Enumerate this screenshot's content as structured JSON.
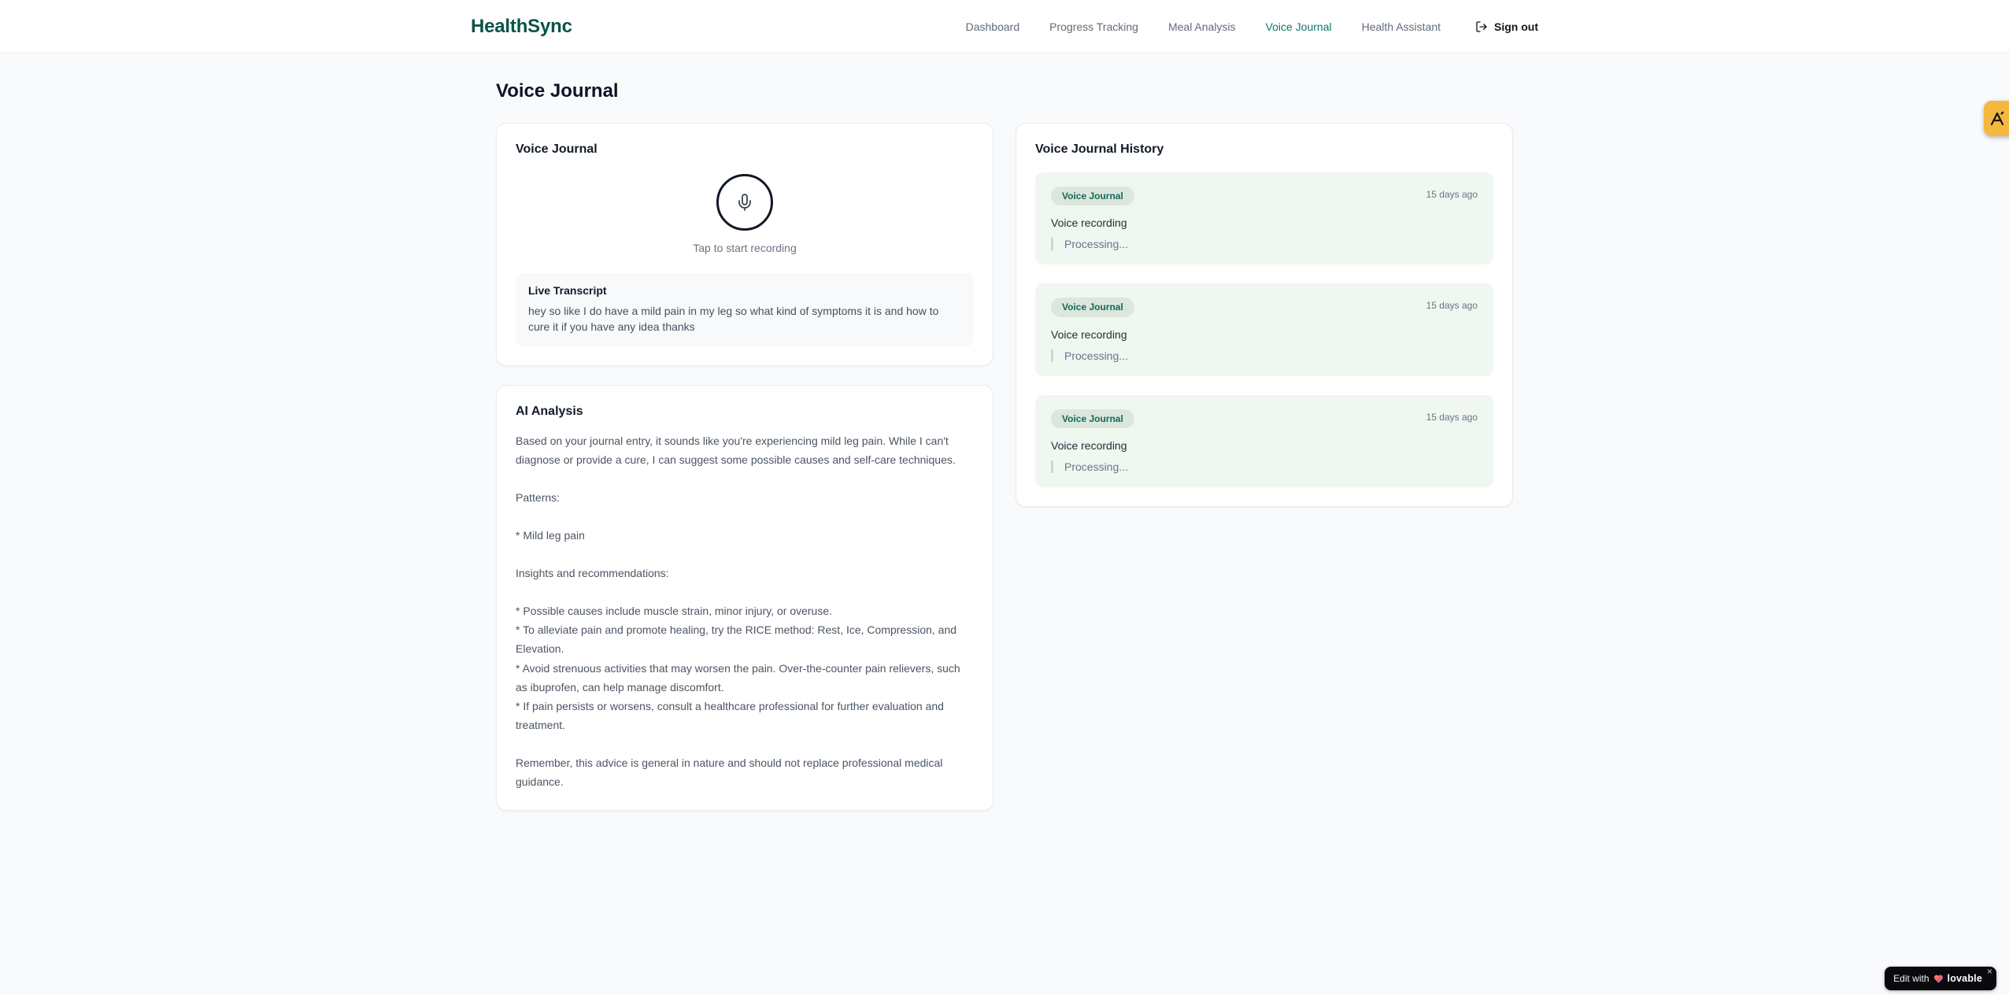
{
  "brand": {
    "name": "HealthSync",
    "color": "#0a5446"
  },
  "nav": {
    "items": [
      {
        "label": "Dashboard",
        "active": false
      },
      {
        "label": "Progress Tracking",
        "active": false
      },
      {
        "label": "Meal Analysis",
        "active": false
      },
      {
        "label": "Voice Journal",
        "active": true
      },
      {
        "label": "Health Assistant",
        "active": false
      }
    ],
    "active_color": "#11756a",
    "sign_out_label": "Sign out"
  },
  "page": {
    "title": "Voice Journal"
  },
  "recorder_card": {
    "title": "Voice Journal",
    "tap_hint": "Tap to start recording",
    "transcript_title": "Live Transcript",
    "transcript_text": "hey so like I do have a mild pain in my leg so what kind of symptoms it is and how to cure it if you have any idea thanks"
  },
  "analysis_card": {
    "title": "AI Analysis",
    "body": "Based on your journal entry, it sounds like you're experiencing mild leg pain. While I can't diagnose or provide a cure, I can suggest some possible causes and self-care techniques.\n\nPatterns:\n\n* Mild leg pain\n\nInsights and recommendations:\n\n* Possible causes include muscle strain, minor injury, or overuse.\n* To alleviate pain and promote healing, try the RICE method: Rest, Ice, Compression, and Elevation.\n* Avoid strenuous activities that may worsen the pain. Over-the-counter pain relievers, such as ibuprofen, can help manage discomfort.\n* If pain persists or worsens, consult a healthcare professional for further evaluation and treatment.\n\nRemember, this advice is general in nature and should not replace professional medical guidance."
  },
  "history_card": {
    "title": "Voice Journal History",
    "entry_bg": "#f0f7f0",
    "badge_bg": "#dbe7dc",
    "badge_text_color": "#18665c",
    "entries": [
      {
        "badge": "Voice Journal",
        "time": "15 days ago",
        "title": "Voice recording",
        "status": "Processing..."
      },
      {
        "badge": "Voice Journal",
        "time": "15 days ago",
        "title": "Voice recording",
        "status": "Processing..."
      },
      {
        "badge": "Voice Journal",
        "time": "15 days ago",
        "title": "Voice recording",
        "status": "Processing..."
      }
    ]
  },
  "overlays": {
    "corner_badge_color": "#f6b73e",
    "edit_badge": {
      "prefix": "Edit with",
      "brand": "lovable",
      "close": "×"
    }
  },
  "icons": {
    "mic": "mic-icon",
    "sign_out": "log-out-icon",
    "heart": "gradient-heart-icon",
    "close": "close-icon",
    "corner_logo": "lovable-select-icon"
  }
}
